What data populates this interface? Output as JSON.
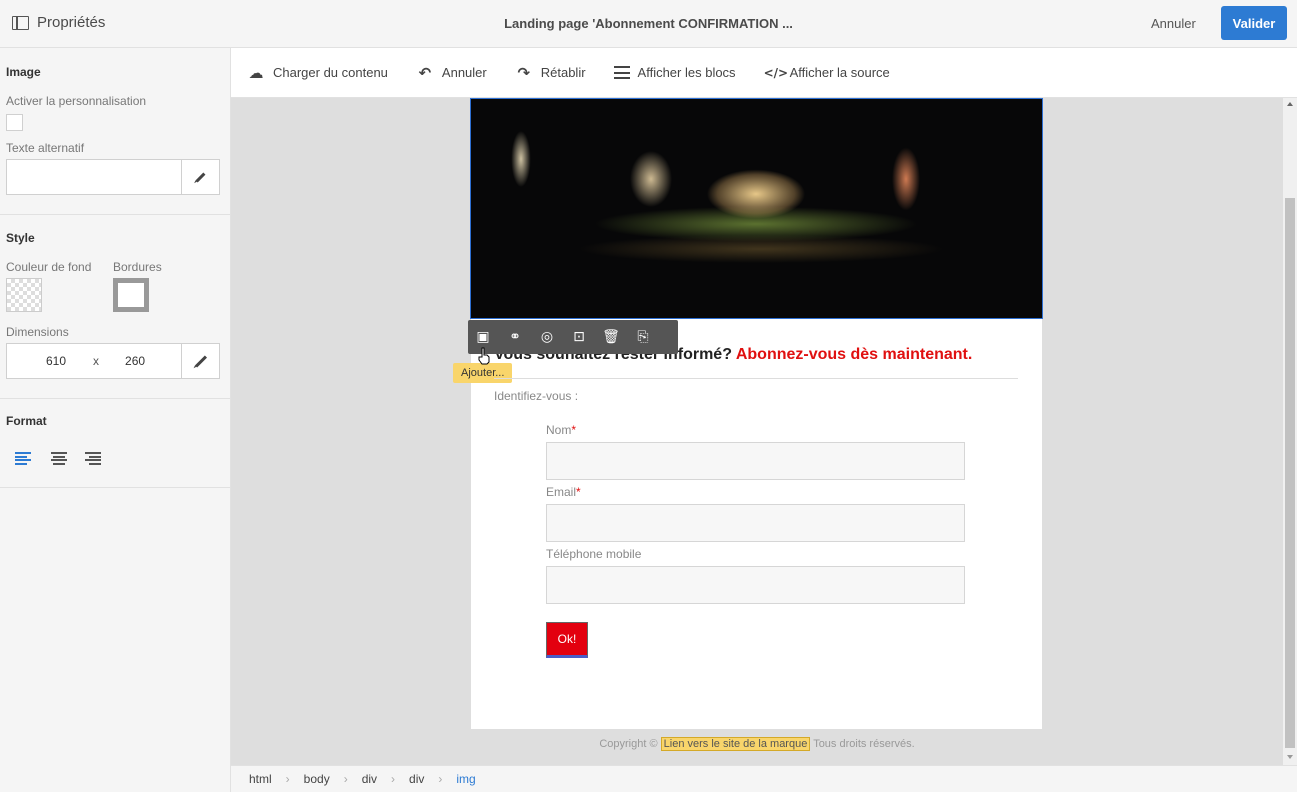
{
  "header": {
    "panel_title": "Propriétés",
    "page_title": "Landing page 'Abonnement CONFIRMATION ...",
    "cancel_label": "Annuler",
    "validate_label": "Valider"
  },
  "sidebar": {
    "image": {
      "title": "Image",
      "personalization_label": "Activer la personnalisation",
      "alt_label": "Texte alternatif",
      "alt_value": ""
    },
    "style": {
      "title": "Style",
      "bg_label": "Couleur de fond",
      "borders_label": "Bordures",
      "dimensions_label": "Dimensions",
      "width": "610",
      "times": "x",
      "height": "260"
    },
    "format": {
      "title": "Format",
      "align_options": [
        "align-left",
        "align-center",
        "align-right"
      ],
      "selected": "align-left"
    }
  },
  "toolbar": {
    "load_label": "Charger du contenu",
    "undo_label": "Annuler",
    "redo_label": "Rétablir",
    "blocks_label": "Afficher les blocs",
    "source_label": "Afficher la source"
  },
  "content": {
    "tooltip": "Ajouter...",
    "heading_black": "Vous souhaitez rester informé?",
    "heading_red": "Abonnez-vous dès maintenant.",
    "identify": "Identifiez-vous :",
    "fields": [
      {
        "label": "Nom",
        "required": "*"
      },
      {
        "label": "Email",
        "required": "*"
      },
      {
        "label": "Téléphone mobile",
        "required": ""
      }
    ],
    "ok_label": "Ok!",
    "footer_prefix": "Copyright ©",
    "footer_link": "Lien vers le site de la marque",
    "footer_suffix": "Tous droits réservés."
  },
  "breadcrumb": [
    "html",
    "body",
    "div",
    "div",
    "img"
  ],
  "colors": {
    "accent": "#2d7bd3",
    "cta_red": "#e3000f",
    "tooltip_yellow": "#f9d56b"
  }
}
